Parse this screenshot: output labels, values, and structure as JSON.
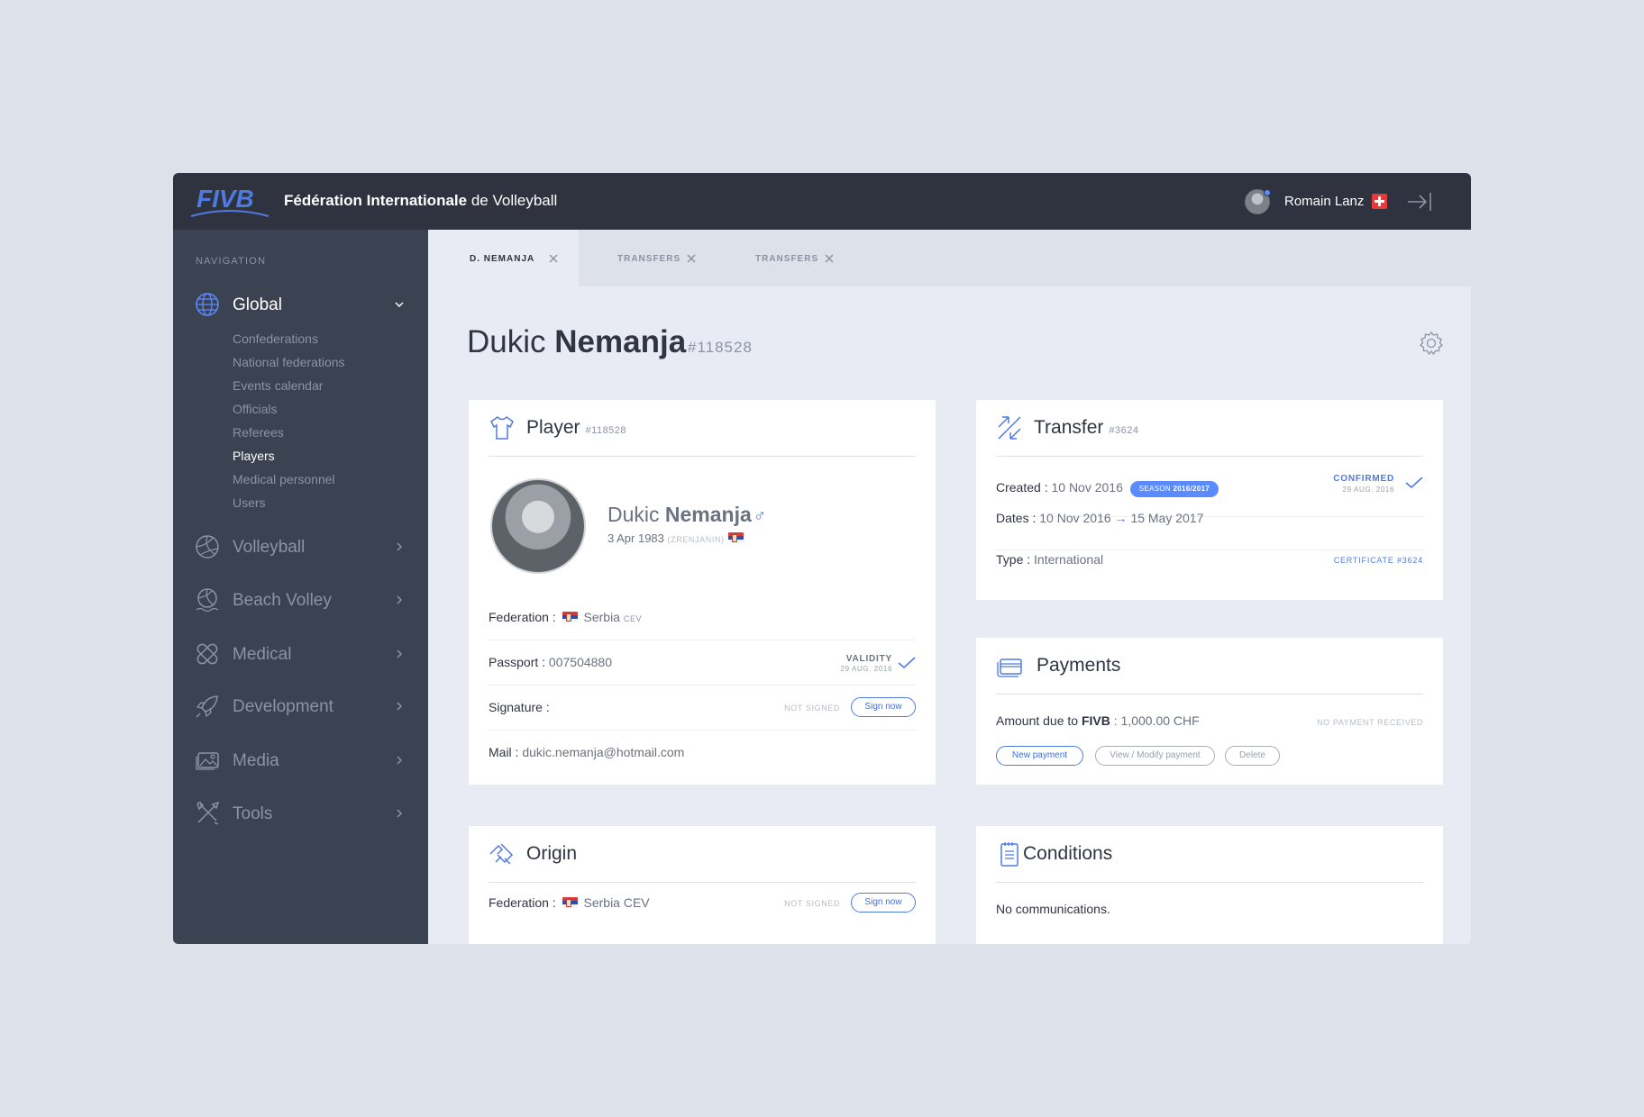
{
  "header": {
    "brand_bold": "Fédération Internationale",
    "brand_rest": "de Volleyball",
    "user_name": "Romain Lanz"
  },
  "sidebar": {
    "heading": "NAVIGATION",
    "items": [
      {
        "label": "Global",
        "icon": "globe-icon",
        "expanded": true
      },
      {
        "label": "Volleyball",
        "icon": "volleyball-icon"
      },
      {
        "label": "Beach Volley",
        "icon": "beach-volley-icon"
      },
      {
        "label": "Medical",
        "icon": "bandage-icon"
      },
      {
        "label": "Development",
        "icon": "rocket-icon"
      },
      {
        "label": "Media",
        "icon": "image-icon"
      },
      {
        "label": "Tools",
        "icon": "tools-icon"
      }
    ],
    "sub_items": [
      "Confederations",
      "National federations",
      "Events calendar",
      "Officials",
      "Referees",
      "Players",
      "Medical personnel",
      "Users"
    ],
    "active_sub": "Players"
  },
  "tabs": [
    {
      "label": "D. NEMANJA",
      "active": true
    },
    {
      "label": "TRANSFERS",
      "active": false
    },
    {
      "label": "TRANSFERS",
      "active": false
    }
  ],
  "page": {
    "first_name": "Dukic",
    "last_name": "Nemanja",
    "id": "#118528"
  },
  "player_card": {
    "title": "Player",
    "id": "#118528",
    "first_name": "Dukic",
    "last_name": "Nemanja",
    "gender_symbol": "♂",
    "birth": "3 Apr 1983",
    "birthplace": "(ZRENJANIN)",
    "federation_label": "Federation :",
    "federation_value": "Serbia",
    "federation_conf": "CEV",
    "passport_label": "Passport :",
    "passport_value": "007504880",
    "validity_label": "VALIDITY",
    "validity_date": "29 AUG. 2016",
    "signature_label": "Signature :",
    "not_signed": "NOT SIGNED",
    "sign_now": "Sign now",
    "mail_label": "Mail :",
    "mail_value": "dukic.nemanja@hotmail.com"
  },
  "transfer_card": {
    "title": "Transfer",
    "id": "#3624",
    "created_label": "Created :",
    "created_value": "10 Nov 2016",
    "season_prefix": "SEASON",
    "season_value": "2016/2017",
    "status": "CONFIRMED",
    "status_date": "29 AUG. 2016",
    "dates_label": "Dates :",
    "date_from": "10 Nov 2016",
    "date_to": "15 May 2017",
    "type_label": "Type :",
    "type_value": "International",
    "certificate": "CERTIFICATE #3624"
  },
  "payments_card": {
    "title": "Payments",
    "amount_label": "Amount due to",
    "amount_org": "FIVB",
    "amount_value": ": 1,000.00 CHF",
    "status": "NO PAYMENT RECEIVED",
    "buttons": [
      "New payment",
      "View / Modify payment",
      "Delete"
    ]
  },
  "origin_card": {
    "title": "Origin",
    "federation_label": "Federation :",
    "federation_value": "Serbia CEV",
    "not_signed": "NOT SIGNED",
    "sign_now": "Sign now"
  },
  "conditions_card": {
    "title": "Conditions",
    "text": "No communications."
  },
  "colors": {
    "accent": "#4f7be0",
    "topbar": "#2e333f",
    "sidebar": "#3b4252",
    "background": "#dde1e9",
    "content": "#e8ebf3"
  }
}
